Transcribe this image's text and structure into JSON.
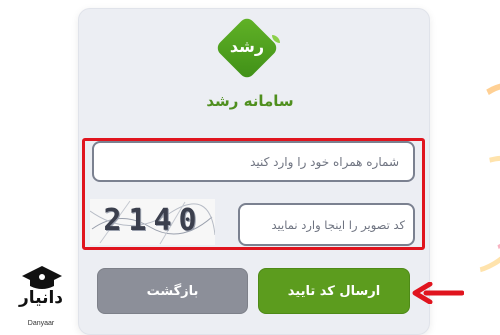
{
  "app": {
    "logo_text": "رشد",
    "system_title": "سامانه رشد"
  },
  "form": {
    "phone_placeholder": "شماره همراه خود را وارد کنید",
    "captcha_placeholder": "کد تصویر را اینجا وارد نمایید",
    "captcha_code": "2140"
  },
  "buttons": {
    "submit_label": "ارسال کد تایید",
    "back_label": "بازگشت"
  },
  "watermark": {
    "name": "دانیار",
    "latin": "Danyaar"
  },
  "colors": {
    "brand_green": "#5c9c1e",
    "highlight_red": "#e0141e",
    "back_gray": "#8c8f99"
  },
  "icons": {
    "arrow": "arrow-left-icon",
    "logo": "roshd-logo-icon",
    "watermark": "graduation-cap-icon"
  }
}
